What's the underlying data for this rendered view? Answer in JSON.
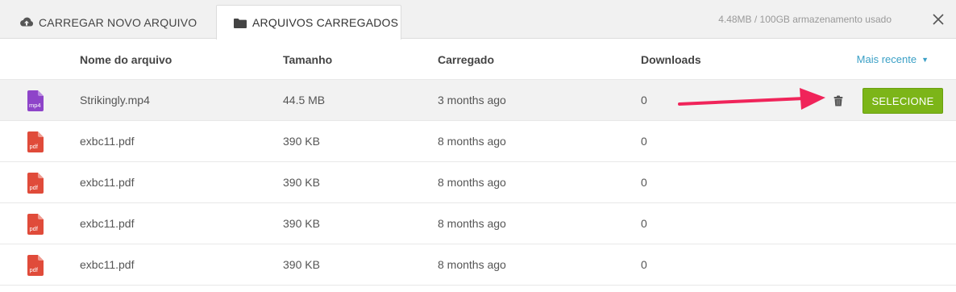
{
  "tabs": [
    {
      "label": "CARREGAR NOVO ARQUIVO",
      "icon": "cloud-upload-icon",
      "active": false
    },
    {
      "label": "ARQUIVOS CARREGADOS",
      "icon": "folder-icon",
      "active": true
    }
  ],
  "storage": "4.48MB / 100GB armazenamento usado",
  "columns": {
    "name": "Nome do arquivo",
    "size": "Tamanho",
    "uploaded": "Carregado",
    "downloads": "Downloads"
  },
  "sort": {
    "label": "Mais recente",
    "caret": "▼"
  },
  "files": [
    {
      "name": "Strikingly.mp4",
      "size": "44.5 MB",
      "uploaded": "3 months ago",
      "downloads": "0",
      "type": "mp4",
      "selected": true
    },
    {
      "name": "exbc11.pdf",
      "size": "390 KB",
      "uploaded": "8 months ago",
      "downloads": "0",
      "type": "pdf",
      "selected": false
    },
    {
      "name": "exbc11.pdf",
      "size": "390 KB",
      "uploaded": "8 months ago",
      "downloads": "0",
      "type": "pdf",
      "selected": false
    },
    {
      "name": "exbc11.pdf",
      "size": "390 KB",
      "uploaded": "8 months ago",
      "downloads": "0",
      "type": "pdf",
      "selected": false
    },
    {
      "name": "exbc11.pdf",
      "size": "390 KB",
      "uploaded": "8 months ago",
      "downloads": "0",
      "type": "pdf",
      "selected": false
    }
  ],
  "select_button": "SELECIONE",
  "colors": {
    "accent": "#7cb518",
    "link": "#3ba0c6",
    "pdf": "#e04b3a",
    "mp4": "#8e44c9",
    "arrow": "#f0245a"
  },
  "icons": {
    "close": "close-icon",
    "delete": "trash-icon"
  }
}
